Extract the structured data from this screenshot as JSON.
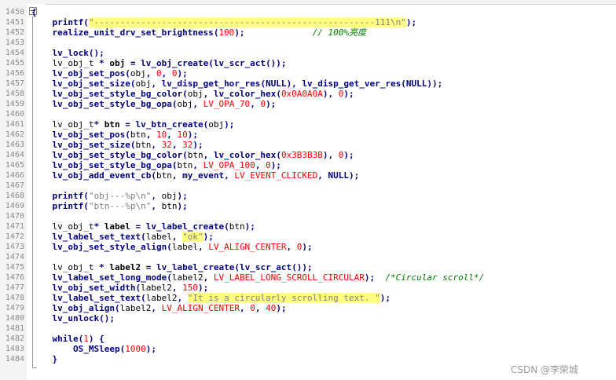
{
  "editor": {
    "line_numbers": [
      "1450",
      "1451",
      "1452",
      "1453",
      "1454",
      "1455",
      "1456",
      "1457",
      "1458",
      "1459",
      "1460",
      "1461",
      "1462",
      "1463",
      "1464",
      "1465",
      "1466",
      "1467",
      "1468",
      "1469",
      "1470",
      "1471",
      "1472",
      "1473",
      "1474",
      "1475",
      "1476",
      "1477",
      "1478",
      "1479",
      "1480",
      "1481",
      "1482",
      "1483",
      "1484"
    ],
    "lines": [
      [
        {
          "t": "{",
          "c": "op"
        }
      ],
      [
        {
          "t": "    "
        },
        {
          "t": "printf",
          "c": "fn"
        },
        {
          "t": "(",
          "c": "op"
        },
        {
          "t": "\"------------------------------------------------------111\\n\"",
          "c": "hl"
        },
        {
          "t": ");",
          "c": "op"
        }
      ],
      [
        {
          "t": "    "
        },
        {
          "t": "realize_unit_drv_set_brightness",
          "c": "fn"
        },
        {
          "t": "(",
          "c": "op"
        },
        {
          "t": "100",
          "c": "num"
        },
        {
          "t": ");",
          "c": "op"
        },
        {
          "t": "             "
        },
        {
          "t": "// 100%亮度",
          "c": "cm"
        }
      ],
      [],
      [
        {
          "t": "    "
        },
        {
          "t": "lv_lock",
          "c": "fn"
        },
        {
          "t": "();",
          "c": "op"
        }
      ],
      [
        {
          "t": "    "
        },
        {
          "t": "lv_obj_t",
          "c": "id"
        },
        {
          "t": " * ",
          "c": "op"
        },
        {
          "t": "obj",
          "c": "idb"
        },
        {
          "t": " = ",
          "c": "op"
        },
        {
          "t": "lv_obj_create",
          "c": "fn"
        },
        {
          "t": "(",
          "c": "op"
        },
        {
          "t": "lv_scr_act",
          "c": "fn"
        },
        {
          "t": "());",
          "c": "op"
        }
      ],
      [
        {
          "t": "    "
        },
        {
          "t": "lv_obj_set_pos",
          "c": "fn"
        },
        {
          "t": "(",
          "c": "op"
        },
        {
          "t": "obj",
          "c": "id"
        },
        {
          "t": ", ",
          "c": "op"
        },
        {
          "t": "0",
          "c": "num"
        },
        {
          "t": ", ",
          "c": "op"
        },
        {
          "t": "0",
          "c": "num"
        },
        {
          "t": ");",
          "c": "op"
        }
      ],
      [
        {
          "t": "    "
        },
        {
          "t": "lv_obj_set_size",
          "c": "fn"
        },
        {
          "t": "(",
          "c": "op"
        },
        {
          "t": "obj",
          "c": "id"
        },
        {
          "t": ", ",
          "c": "op"
        },
        {
          "t": "lv_disp_get_hor_res",
          "c": "fn"
        },
        {
          "t": "(",
          "c": "op"
        },
        {
          "t": "NULL",
          "c": "fn"
        },
        {
          "t": "), ",
          "c": "op"
        },
        {
          "t": "lv_disp_get_ver_res",
          "c": "fn"
        },
        {
          "t": "(",
          "c": "op"
        },
        {
          "t": "NULL",
          "c": "fn"
        },
        {
          "t": "));",
          "c": "op"
        }
      ],
      [
        {
          "t": "    "
        },
        {
          "t": "lv_obj_set_style_bg_color",
          "c": "fn"
        },
        {
          "t": "(",
          "c": "op"
        },
        {
          "t": "obj",
          "c": "id"
        },
        {
          "t": ", ",
          "c": "op"
        },
        {
          "t": "lv_color_hex",
          "c": "fn"
        },
        {
          "t": "(",
          "c": "op"
        },
        {
          "t": "0x0A0A0A",
          "c": "num"
        },
        {
          "t": "), ",
          "c": "op"
        },
        {
          "t": "0",
          "c": "num"
        },
        {
          "t": ");",
          "c": "op"
        }
      ],
      [
        {
          "t": "    "
        },
        {
          "t": "lv_obj_set_style_bg_opa",
          "c": "fn"
        },
        {
          "t": "(",
          "c": "op"
        },
        {
          "t": "obj",
          "c": "id"
        },
        {
          "t": ", ",
          "c": "op"
        },
        {
          "t": "LV_OPA_70",
          "c": "const"
        },
        {
          "t": ", ",
          "c": "op"
        },
        {
          "t": "0",
          "c": "num"
        },
        {
          "t": ");",
          "c": "op"
        }
      ],
      [],
      [
        {
          "t": "    "
        },
        {
          "t": "lv_obj_t",
          "c": "id"
        },
        {
          "t": "* ",
          "c": "op"
        },
        {
          "t": "btn",
          "c": "idb"
        },
        {
          "t": " = ",
          "c": "op"
        },
        {
          "t": "lv_btn_create",
          "c": "fn"
        },
        {
          "t": "(",
          "c": "op"
        },
        {
          "t": "obj",
          "c": "id"
        },
        {
          "t": ");",
          "c": "op"
        }
      ],
      [
        {
          "t": "    "
        },
        {
          "t": "lv_obj_set_pos",
          "c": "fn"
        },
        {
          "t": "(",
          "c": "op"
        },
        {
          "t": "btn",
          "c": "id"
        },
        {
          "t": ", ",
          "c": "op"
        },
        {
          "t": "10",
          "c": "num"
        },
        {
          "t": ", ",
          "c": "op"
        },
        {
          "t": "10",
          "c": "num"
        },
        {
          "t": ");",
          "c": "op"
        }
      ],
      [
        {
          "t": "    "
        },
        {
          "t": "lv_obj_set_size",
          "c": "fn"
        },
        {
          "t": "(",
          "c": "op"
        },
        {
          "t": "btn",
          "c": "id"
        },
        {
          "t": ", ",
          "c": "op"
        },
        {
          "t": "32",
          "c": "num"
        },
        {
          "t": ", ",
          "c": "op"
        },
        {
          "t": "32",
          "c": "num"
        },
        {
          "t": ");",
          "c": "op"
        }
      ],
      [
        {
          "t": "    "
        },
        {
          "t": "lv_obj_set_style_bg_color",
          "c": "fn"
        },
        {
          "t": "(",
          "c": "op"
        },
        {
          "t": "btn",
          "c": "id"
        },
        {
          "t": ", ",
          "c": "op"
        },
        {
          "t": "lv_color_hex",
          "c": "fn"
        },
        {
          "t": "(",
          "c": "op"
        },
        {
          "t": "0x3B3B3B",
          "c": "num"
        },
        {
          "t": "), ",
          "c": "op"
        },
        {
          "t": "0",
          "c": "num"
        },
        {
          "t": ");",
          "c": "op"
        }
      ],
      [
        {
          "t": "    "
        },
        {
          "t": "lv_obj_set_style_bg_opa",
          "c": "fn"
        },
        {
          "t": "(",
          "c": "op"
        },
        {
          "t": "btn",
          "c": "id"
        },
        {
          "t": ", ",
          "c": "op"
        },
        {
          "t": "LV_OPA_100",
          "c": "const"
        },
        {
          "t": ", ",
          "c": "op"
        },
        {
          "t": "0",
          "c": "num"
        },
        {
          "t": ");",
          "c": "op"
        }
      ],
      [
        {
          "t": "    "
        },
        {
          "t": "lv_obj_add_event_cb",
          "c": "fn"
        },
        {
          "t": "(",
          "c": "op"
        },
        {
          "t": "btn",
          "c": "id"
        },
        {
          "t": ", ",
          "c": "op"
        },
        {
          "t": "my_event",
          "c": "fn"
        },
        {
          "t": ", ",
          "c": "op"
        },
        {
          "t": "LV_EVENT_CLICKED",
          "c": "const"
        },
        {
          "t": ", ",
          "c": "op"
        },
        {
          "t": "NULL",
          "c": "fn"
        },
        {
          "t": ");",
          "c": "op"
        }
      ],
      [],
      [
        {
          "t": "    "
        },
        {
          "t": "printf",
          "c": "fn"
        },
        {
          "t": "(",
          "c": "op"
        },
        {
          "t": "\"obj---%p\\n\"",
          "c": "str"
        },
        {
          "t": ", ",
          "c": "op"
        },
        {
          "t": "obj",
          "c": "id"
        },
        {
          "t": ");",
          "c": "op"
        }
      ],
      [
        {
          "t": "    "
        },
        {
          "t": "printf",
          "c": "fn"
        },
        {
          "t": "(",
          "c": "op"
        },
        {
          "t": "\"btn---%p\\n\"",
          "c": "str"
        },
        {
          "t": ", ",
          "c": "op"
        },
        {
          "t": "btn",
          "c": "id"
        },
        {
          "t": ");",
          "c": "op"
        }
      ],
      [],
      [
        {
          "t": "    "
        },
        {
          "t": "lv_obj_t",
          "c": "id"
        },
        {
          "t": "* ",
          "c": "op"
        },
        {
          "t": "label",
          "c": "idb"
        },
        {
          "t": " = ",
          "c": "op"
        },
        {
          "t": "lv_label_create",
          "c": "fn"
        },
        {
          "t": "(",
          "c": "op"
        },
        {
          "t": "btn",
          "c": "id"
        },
        {
          "t": ");",
          "c": "op"
        }
      ],
      [
        {
          "t": "    "
        },
        {
          "t": "lv_label_set_text",
          "c": "fn"
        },
        {
          "t": "(",
          "c": "op"
        },
        {
          "t": "label",
          "c": "id"
        },
        {
          "t": ", ",
          "c": "op"
        },
        {
          "t": "\"ok\"",
          "c": "hl"
        },
        {
          "t": ");",
          "c": "op"
        }
      ],
      [
        {
          "t": "    "
        },
        {
          "t": "lv_obj_set_style_align",
          "c": "fn"
        },
        {
          "t": "(",
          "c": "op"
        },
        {
          "t": "label",
          "c": "id"
        },
        {
          "t": ", ",
          "c": "op"
        },
        {
          "t": "LV_ALIGN_CENTER",
          "c": "const"
        },
        {
          "t": ", ",
          "c": "op"
        },
        {
          "t": "0",
          "c": "num"
        },
        {
          "t": ");",
          "c": "op"
        }
      ],
      [],
      [
        {
          "t": "    "
        },
        {
          "t": "lv_obj_t",
          "c": "id"
        },
        {
          "t": " * ",
          "c": "op"
        },
        {
          "t": "label2",
          "c": "idb"
        },
        {
          "t": " = ",
          "c": "op"
        },
        {
          "t": "lv_label_create",
          "c": "fn"
        },
        {
          "t": "(",
          "c": "op"
        },
        {
          "t": "lv_scr_act",
          "c": "fn"
        },
        {
          "t": "());",
          "c": "op"
        }
      ],
      [
        {
          "t": "    "
        },
        {
          "t": "lv_label_set_long_mode",
          "c": "fn"
        },
        {
          "t": "(",
          "c": "op"
        },
        {
          "t": "label2",
          "c": "id"
        },
        {
          "t": ", ",
          "c": "op"
        },
        {
          "t": "LV_LABEL_LONG_SCROLL_CIRCULAR",
          "c": "const"
        },
        {
          "t": ");",
          "c": "op"
        },
        {
          "t": "  "
        },
        {
          "t": "/*Circular scroll*/",
          "c": "cm"
        }
      ],
      [
        {
          "t": "    "
        },
        {
          "t": "lv_obj_set_width",
          "c": "fn"
        },
        {
          "t": "(",
          "c": "op"
        },
        {
          "t": "label2",
          "c": "id"
        },
        {
          "t": ", ",
          "c": "op"
        },
        {
          "t": "150",
          "c": "num"
        },
        {
          "t": ");",
          "c": "op"
        }
      ],
      [
        {
          "t": "    "
        },
        {
          "t": "lv_label_set_text",
          "c": "fn"
        },
        {
          "t": "(",
          "c": "op"
        },
        {
          "t": "label2",
          "c": "id"
        },
        {
          "t": ", ",
          "c": "op"
        },
        {
          "t": "\"It is a circularly scrolling text. \"",
          "c": "hl"
        },
        {
          "t": ");",
          "c": "op"
        }
      ],
      [
        {
          "t": "    "
        },
        {
          "t": "lv_obj_align",
          "c": "fn"
        },
        {
          "t": "(",
          "c": "op"
        },
        {
          "t": "label2",
          "c": "id"
        },
        {
          "t": ", ",
          "c": "op"
        },
        {
          "t": "LV_ALIGN_CENTER",
          "c": "const"
        },
        {
          "t": ", ",
          "c": "op"
        },
        {
          "t": "0",
          "c": "num"
        },
        {
          "t": ", ",
          "c": "op"
        },
        {
          "t": "40",
          "c": "num"
        },
        {
          "t": ");",
          "c": "op"
        }
      ],
      [
        {
          "t": "    "
        },
        {
          "t": "lv_unlock",
          "c": "fn"
        },
        {
          "t": "();",
          "c": "op"
        }
      ],
      [],
      [
        {
          "t": "    "
        },
        {
          "t": "while",
          "c": "kw"
        },
        {
          "t": "(",
          "c": "op"
        },
        {
          "t": "1",
          "c": "num"
        },
        {
          "t": ") {",
          "c": "op"
        }
      ],
      [
        {
          "t": "        "
        },
        {
          "t": "OS_MSleep",
          "c": "fn"
        },
        {
          "t": "(",
          "c": "op"
        },
        {
          "t": "1000",
          "c": "num"
        },
        {
          "t": ");",
          "c": "op"
        }
      ],
      [
        {
          "t": "    "
        },
        {
          "t": "}",
          "c": "op"
        }
      ]
    ]
  },
  "watermark": "CSDN @李荣城"
}
